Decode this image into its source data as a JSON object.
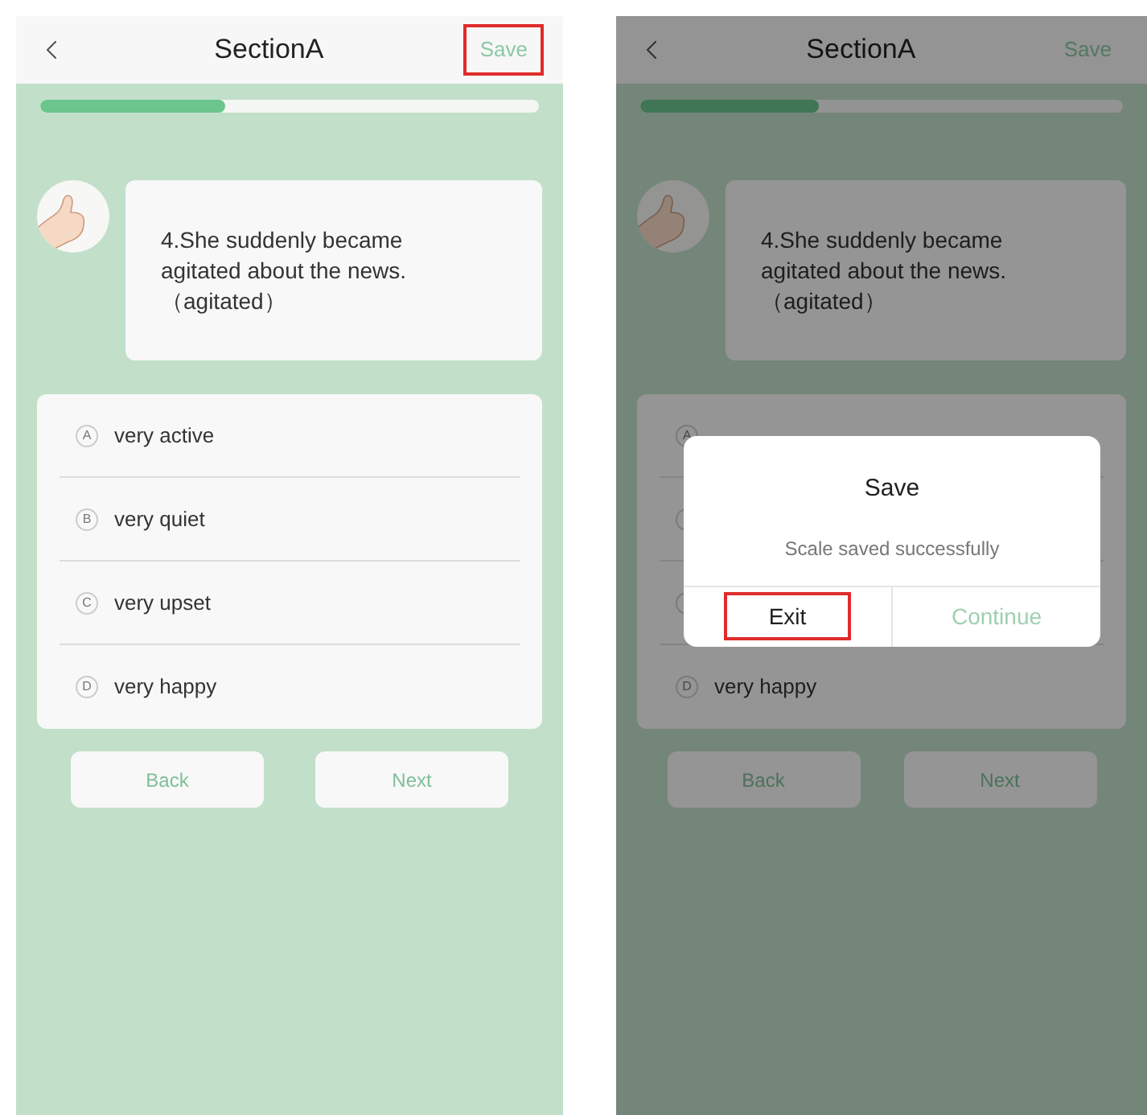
{
  "screens": [
    {
      "header": {
        "title": "SectionA",
        "save": {
          "label": "Save",
          "highlighted": true
        }
      },
      "progress": {
        "level": 0.37
      },
      "question": {
        "text": "4.She suddenly became agitated about the news.",
        "hint": "（agitated）"
      },
      "options": [
        {
          "letter": "A",
          "text": "very active"
        },
        {
          "letter": "B",
          "text": "very quiet"
        },
        {
          "letter": "C",
          "text": "very upset"
        },
        {
          "letter": "D",
          "text": "very happy"
        }
      ],
      "buttons": [
        {
          "label": "Back"
        },
        {
          "label": "Next"
        }
      ]
    },
    {
      "header": {
        "title": "SectionA",
        "save": {
          "label": "Save",
          "highlighted": false
        }
      },
      "progress": {
        "level": 0.37
      },
      "question": {
        "text": "4.She suddenly became agitated about the news.",
        "hint": "（agitated）"
      },
      "options": [
        {
          "kind": "partly_covered",
          "letter": "A"
        },
        {
          "kind": "covered"
        },
        {
          "kind": "covered"
        },
        {
          "kind": "shown",
          "letter": "D",
          "text": "very happy"
        }
      ],
      "buttons": [
        {
          "label": "Back"
        },
        {
          "label": "Next"
        }
      ],
      "dialog": {
        "title": "Save",
        "message": "Scale saved successfully",
        "actions": [
          {
            "kind": "exit",
            "label": "Exit",
            "highlighted": true
          },
          {
            "kind": "continue",
            "label": "Continue",
            "highlighted": false
          }
        ]
      }
    }
  ]
}
